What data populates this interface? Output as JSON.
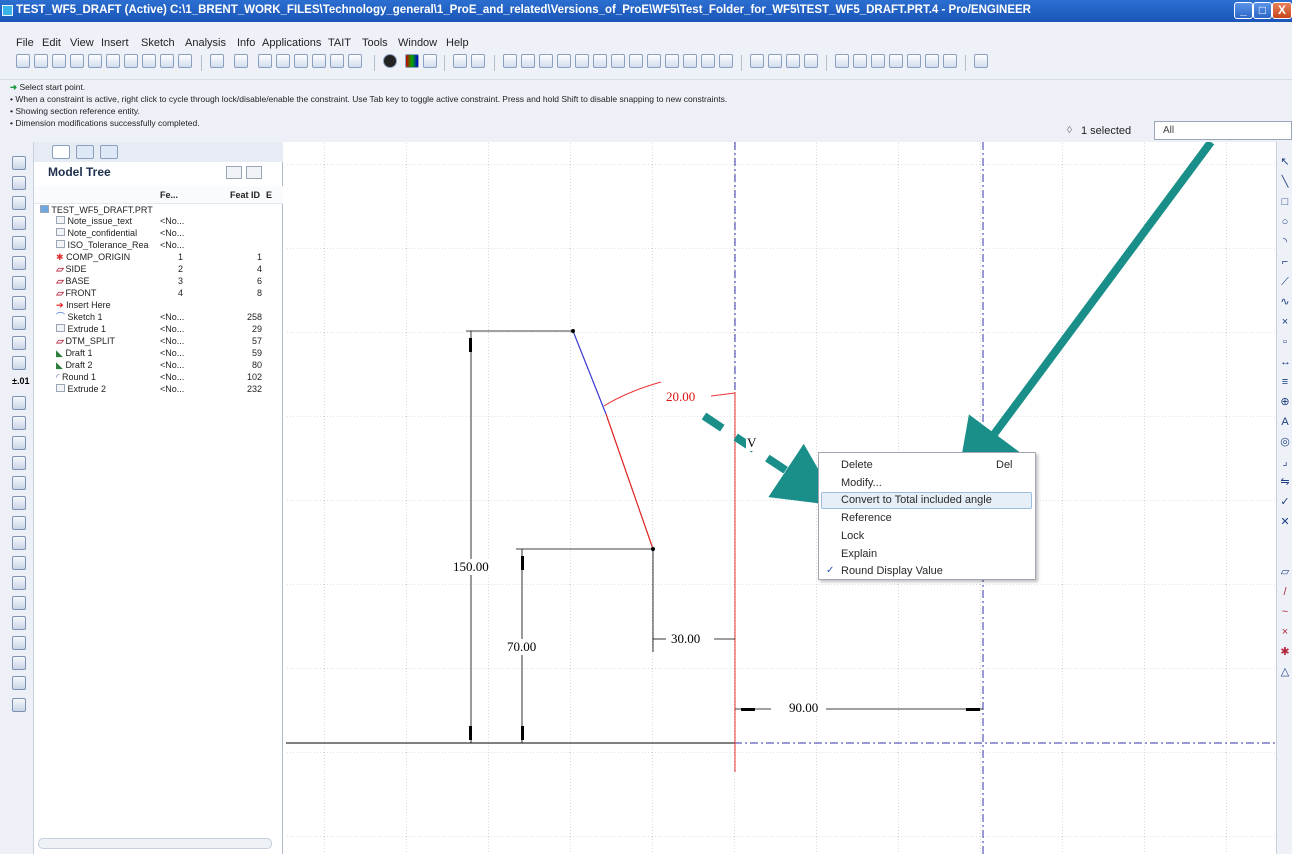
{
  "window": {
    "title": "TEST_WF5_DRAFT (Active) C:\\1_BRENT_WORK_FILES\\Technology_general\\1_ProE_and_related\\Versions_of_ProE\\WF5\\Test_Folder_for_WF5\\TEST_WF5_DRAFT.PRT.4 - Pro/ENGINEER",
    "minimize": "_",
    "maximize": "□",
    "close": "X"
  },
  "menu": [
    "File",
    "Edit",
    "View",
    "Insert",
    "Sketch",
    "Analysis",
    "Info",
    "Applications",
    "TAIT",
    "Tools",
    "Window",
    "Help"
  ],
  "messages": [
    "Select start point.",
    "• When a constraint is active, right click to cycle through lock/disable/enable the constraint. Use Tab key to toggle active constraint. Press and hold Shift to disable snapping to new constraints.",
    "• Showing section reference entity.",
    "• Dimension modifications successfully completed."
  ],
  "selection": {
    "count": "1 selected",
    "filter": "All"
  },
  "model_tree": {
    "title": "Model Tree",
    "columns": [
      "Fe...",
      "Feat ID",
      "E"
    ],
    "rows": [
      {
        "name": "TEST_WF5_DRAFT.PRT",
        "fe": "",
        "id": ""
      },
      {
        "name": "Note_issue_text",
        "fe": "<No...",
        "id": ""
      },
      {
        "name": "Note_confidential",
        "fe": "<No...",
        "id": ""
      },
      {
        "name": "ISO_Tolerance_Rea",
        "fe": "<No...",
        "id": ""
      },
      {
        "name": "COMP_ORIGIN",
        "fe": "1",
        "id": "1"
      },
      {
        "name": "SIDE",
        "fe": "2",
        "id": "4"
      },
      {
        "name": "BASE",
        "fe": "3",
        "id": "6"
      },
      {
        "name": "FRONT",
        "fe": "4",
        "id": "8"
      },
      {
        "name": "Insert Here",
        "fe": "",
        "id": ""
      },
      {
        "name": "Sketch 1",
        "fe": "<No...",
        "id": "258"
      },
      {
        "name": "Extrude 1",
        "fe": "<No...",
        "id": "29"
      },
      {
        "name": "DTM_SPLIT",
        "fe": "<No...",
        "id": "57"
      },
      {
        "name": "Draft 1",
        "fe": "<No...",
        "id": "59"
      },
      {
        "name": "Draft 2",
        "fe": "<No...",
        "id": "80"
      },
      {
        "name": "Round 1",
        "fe": "<No...",
        "id": "102"
      },
      {
        "name": "Extrude 2",
        "fe": "<No...",
        "id": "232"
      }
    ]
  },
  "dimensions": {
    "angle": "20.00",
    "height_150": "150.00",
    "height_70": "70.00",
    "offset_30": "30.00",
    "offset_90": "90.00",
    "v_label": "V"
  },
  "context_menu": {
    "items": [
      "Delete",
      "Modify...",
      "Convert to Total included angle",
      "Reference",
      "Lock",
      "Explain",
      "Round Display Value"
    ],
    "shortcut_delete": "Del",
    "check": "✓"
  },
  "colors": {
    "annotation_arrow": "#1a8f8a",
    "dimension_red": "#dd1111",
    "sketch_blue": "#3a3ad0",
    "title_bar": "#1f5fc4"
  }
}
